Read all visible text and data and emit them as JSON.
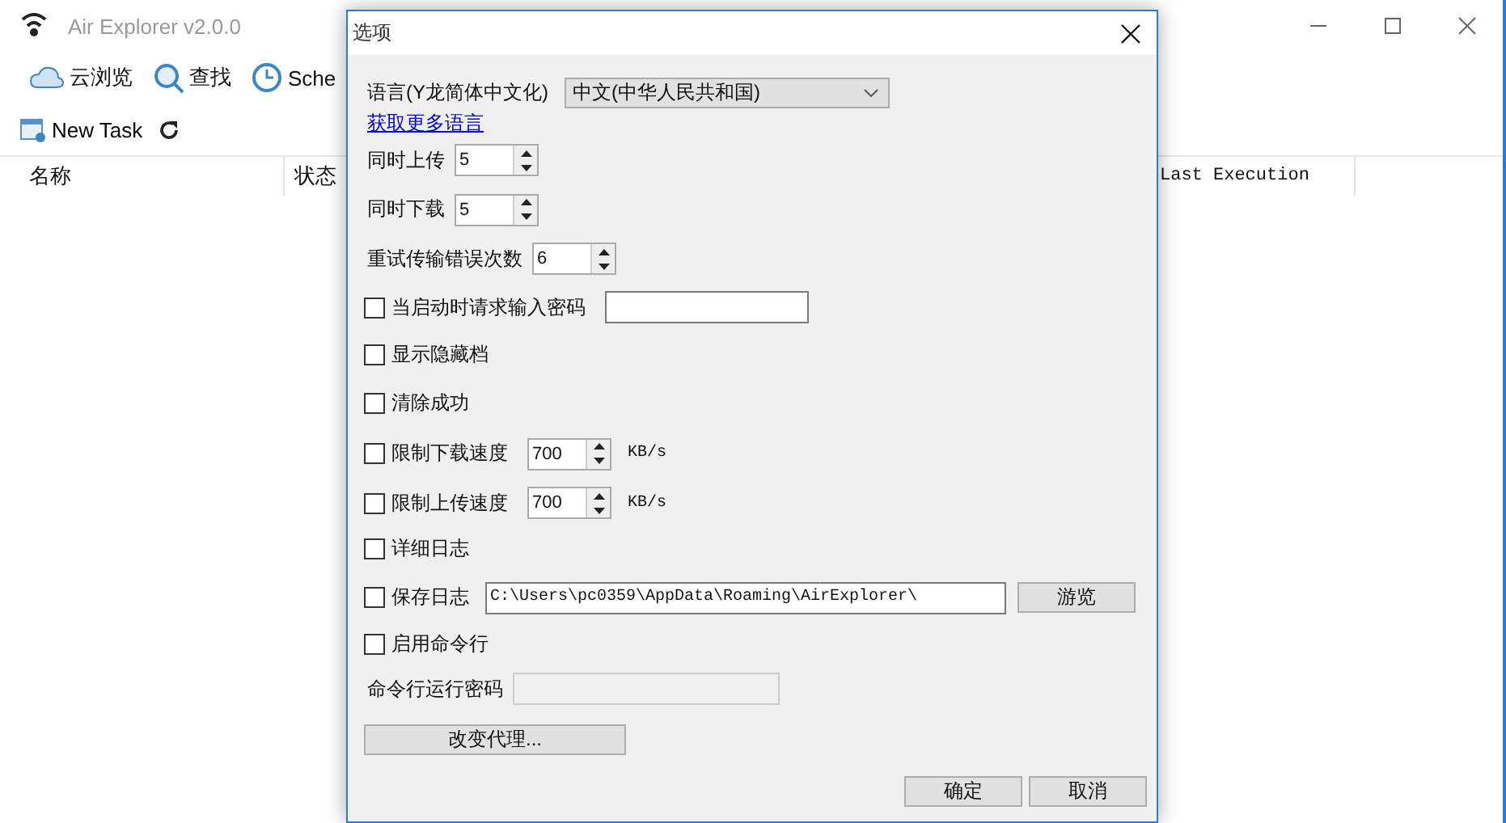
{
  "window": {
    "title": "Air Explorer v2.0.0"
  },
  "tabs": [
    {
      "label": "云浏览"
    },
    {
      "label": "查找"
    },
    {
      "label": "Sche"
    }
  ],
  "toolbar": {
    "new_task": "New Task"
  },
  "columns": [
    {
      "label": "名称"
    },
    {
      "label": "状态"
    },
    {
      "label": "Last Execution"
    }
  ],
  "dialog": {
    "title": "选项",
    "language": {
      "label": "语言(Y龙简体中文化)",
      "value": "中文(中华人民共和国)"
    },
    "link": "获取更多语言",
    "options": [
      {
        "kind": "spin",
        "label": "同时上传",
        "value": "5"
      },
      {
        "kind": "spin",
        "label": "同时下载",
        "value": "5"
      },
      {
        "kind": "spin",
        "label": "重试传输错误次数",
        "value": "6"
      },
      {
        "kind": "check_field",
        "label": "当启动时请求输入密码",
        "checked": false
      },
      {
        "kind": "check",
        "label": "显示隐藏档",
        "checked": false
      },
      {
        "kind": "check",
        "label": "清除成功",
        "checked": false
      },
      {
        "kind": "check_spin",
        "label": "限制下载速度",
        "checked": false,
        "value": "700",
        "unit": "KB/s"
      },
      {
        "kind": "check_spin",
        "label": "限制上传速度",
        "checked": false,
        "value": "700",
        "unit": "KB/s"
      },
      {
        "kind": "check",
        "label": "详细日志",
        "checked": false
      },
      {
        "kind": "check_path",
        "label": "保存日志",
        "checked": false,
        "value": "C:\\Users\\pc0359\\AppData\\Roaming\\AirExplorer\\",
        "button": "游览"
      },
      {
        "kind": "check",
        "label": "启用命令行",
        "checked": false
      },
      {
        "kind": "field",
        "label": "命令行运行密码",
        "disabled": true
      }
    ],
    "proxy_button": "改变代理...",
    "buttons": [
      "确定",
      "取消"
    ]
  }
}
